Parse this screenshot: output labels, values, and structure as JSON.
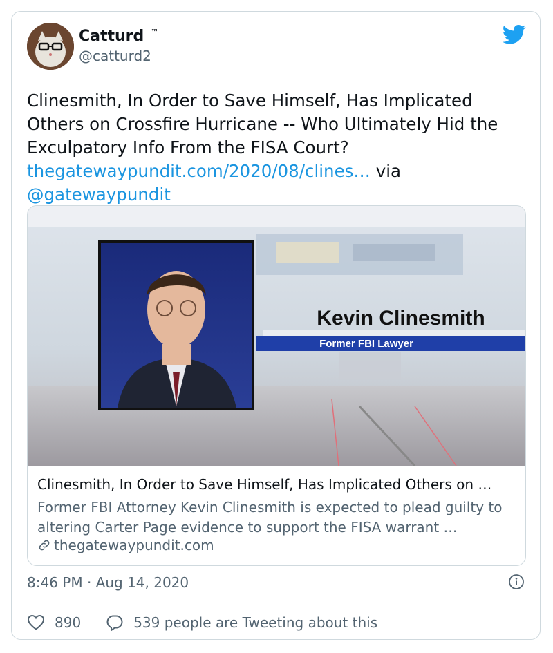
{
  "user": {
    "name": "Catturd",
    "tm": "™",
    "handle": "@catturd2"
  },
  "tweet": {
    "text": "Clinesmith, In Order to Save Himself, Has Implicated Others on Crossfire Hurricane -- Who Ultimately Hid the Exculpatory Info From the FISA Court?",
    "link": "thegatewaypundit.com/2020/08/clines…",
    "via": "via",
    "mention": "@gatewaypundit"
  },
  "link_card": {
    "image_caption_name": "Kevin Clinesmith",
    "image_caption_subtitle": "Former FBI Lawyer",
    "title": "Clinesmith, In Order to Save Himself, Has Implicated Others on …",
    "description": "Former FBI Attorney Kevin Clinesmith is expected to plead guilty to altering Carter Page evidence to support the FISA warrant …",
    "domain": "thegatewaypundit.com"
  },
  "meta": {
    "timestamp": "8:46 PM · Aug 14, 2020"
  },
  "actions": {
    "likes": "890",
    "replies_text": "539 people are Tweeting about this"
  },
  "colors": {
    "link": "#1b95e0",
    "secondary_text": "#536471",
    "border": "#cfd9de",
    "twitter_blue": "#1da1f2"
  },
  "icons": [
    "twitter-bird-icon",
    "link-icon",
    "info-icon",
    "heart-icon",
    "speech-bubble-icon"
  ]
}
